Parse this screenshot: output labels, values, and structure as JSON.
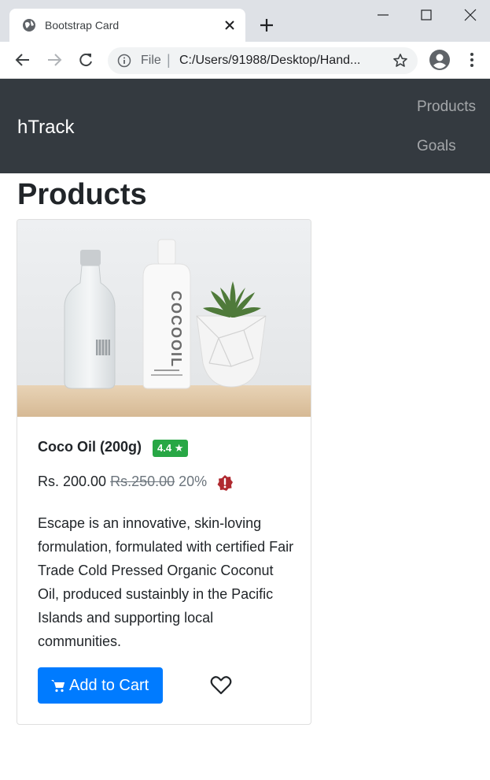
{
  "browser": {
    "tab_title": "Bootstrap Card",
    "url_scheme_label": "File",
    "url": "C:/Users/91988/Desktop/Hand...",
    "icons": [
      "globe-icon",
      "close-icon",
      "plus-icon",
      "minimize-icon",
      "maximize-icon",
      "close-window-icon",
      "back-icon",
      "forward-icon",
      "reload-icon",
      "info-icon",
      "star-icon",
      "profile-icon",
      "menu-icon"
    ]
  },
  "navbar": {
    "brand": "hTrack",
    "links": [
      "Products",
      "Goals"
    ],
    "background": "#343a40"
  },
  "page": {
    "title": "Products"
  },
  "product": {
    "name": "Coco Oil (200g)",
    "rating": "4.4",
    "rating_star": "★",
    "price": "Rs. 200.00",
    "original_price": "Rs.250.00",
    "discount": "20%",
    "description": "Escape is an innovative, skin-loving formulation, formulated with certified Fair Trade Cold Pressed Organic Coconut Oil, produced sustainbly in the Pacific Islands and supporting local communities.",
    "bottle_label": "COCOOIL",
    "add_to_cart_label": "Add to Cart",
    "accent_color": "#007bff",
    "rating_color": "#28a745",
    "icons": [
      "cart-icon",
      "heart-icon",
      "alert-icon"
    ]
  }
}
